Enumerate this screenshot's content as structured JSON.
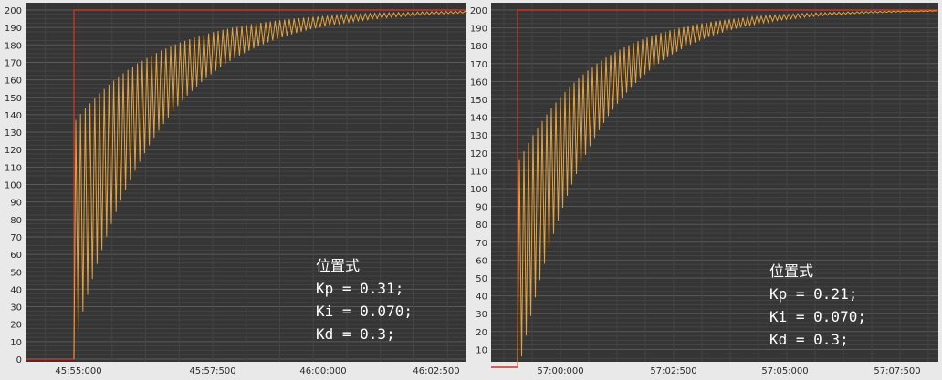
{
  "chart_data": [
    {
      "type": "line",
      "ylim": [
        0,
        200
      ],
      "y_ticks": [
        "0",
        "10",
        "20",
        "30",
        "40",
        "50",
        "60",
        "70",
        "80",
        "90",
        "100",
        "110",
        "120",
        "130",
        "140",
        "150",
        "160",
        "170",
        "180",
        "190",
        "200"
      ],
      "x_ticks": [
        "45:55:000",
        "45:57:500",
        "46:00:000",
        "46:02:500"
      ],
      "series": [
        {
          "role": "setpoint",
          "color": "#c0392b",
          "values": [
            0,
            200
          ]
        },
        {
          "role": "response",
          "color": "#e6a23c"
        }
      ],
      "response_summary": {
        "overshoot": false,
        "peak_first_cycle": 137,
        "final": 200
      },
      "annotations": [
        "位置式",
        "Kp = 0.31;",
        "Ki = 0.070;",
        "Kd = 0.3;"
      ],
      "grid": true
    },
    {
      "type": "line",
      "ylim": [
        0,
        200
      ],
      "y_ticks": [
        "10",
        "20",
        "30",
        "40",
        "50",
        "60",
        "70",
        "80",
        "90",
        "100",
        "110",
        "120",
        "130",
        "140",
        "150",
        "160",
        "170",
        "180",
        "190",
        "200"
      ],
      "x_ticks": [
        "57:00:000",
        "57:02:500",
        "57:05:000",
        "57:07:500"
      ],
      "series": [
        {
          "role": "setpoint",
          "color": "#c0392b",
          "values": [
            0,
            200
          ]
        },
        {
          "role": "response",
          "color": "#e6a23c"
        }
      ],
      "response_summary": {
        "overshoot": false,
        "peak_first_cycle": 116,
        "final": 200
      },
      "annotations": [
        "位置式",
        "Kp = 0.21;",
        "Ki = 0.070;",
        "Kd = 0.3;"
      ],
      "grid": true
    }
  ]
}
